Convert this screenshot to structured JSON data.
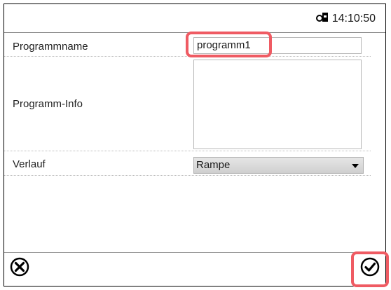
{
  "status": {
    "time": "14:10:50",
    "icon": "door-lock-icon"
  },
  "form": {
    "program_name": {
      "label": "Programmname",
      "value": "programm1"
    },
    "program_info": {
      "label": "Programm-Info",
      "value": ""
    },
    "course": {
      "label": "Verlauf",
      "selected": "Rampe"
    }
  },
  "actions": {
    "cancel_icon": "cancel-circle-icon",
    "confirm_icon": "confirm-check-icon"
  },
  "colors": {
    "highlight": "#ef5b63",
    "border": "#000000"
  }
}
